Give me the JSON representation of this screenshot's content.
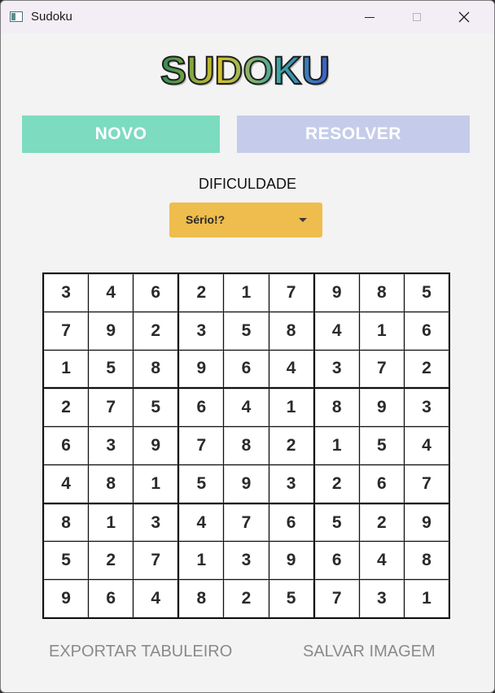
{
  "window": {
    "title": "Sudoku",
    "icon": "app-window-icon"
  },
  "header": {
    "logo_text": "SUDOKU"
  },
  "actions": {
    "new_label": "NOVO",
    "solve_label": "RESOLVER"
  },
  "difficulty": {
    "label": "DIFICULDADE",
    "selected": "Sério!?"
  },
  "board": {
    "rows": [
      [
        "3",
        "4",
        "6",
        "2",
        "1",
        "7",
        "9",
        "8",
        "5"
      ],
      [
        "7",
        "9",
        "2",
        "3",
        "5",
        "8",
        "4",
        "1",
        "6"
      ],
      [
        "1",
        "5",
        "8",
        "9",
        "6",
        "4",
        "3",
        "7",
        "2"
      ],
      [
        "2",
        "7",
        "5",
        "6",
        "4",
        "1",
        "8",
        "9",
        "3"
      ],
      [
        "6",
        "3",
        "9",
        "7",
        "8",
        "2",
        "1",
        "5",
        "4"
      ],
      [
        "4",
        "8",
        "1",
        "5",
        "9",
        "3",
        "2",
        "6",
        "7"
      ],
      [
        "8",
        "1",
        "3",
        "4",
        "7",
        "6",
        "5",
        "2",
        "9"
      ],
      [
        "5",
        "2",
        "7",
        "1",
        "3",
        "9",
        "6",
        "4",
        "8"
      ],
      [
        "9",
        "6",
        "4",
        "8",
        "2",
        "5",
        "7",
        "3",
        "1"
      ]
    ]
  },
  "footer": {
    "export_label": "EXPORTAR TABULEIRO",
    "save_label": "SALVAR IMAGEM"
  },
  "colors": {
    "new_button": "#7ddbc0",
    "solve_button": "#c5cceb",
    "difficulty_select": "#efbd4d",
    "logo_gradient": [
      "#2e8b57",
      "#d4c12a",
      "#3aa6a6",
      "#3a5fd0"
    ]
  }
}
